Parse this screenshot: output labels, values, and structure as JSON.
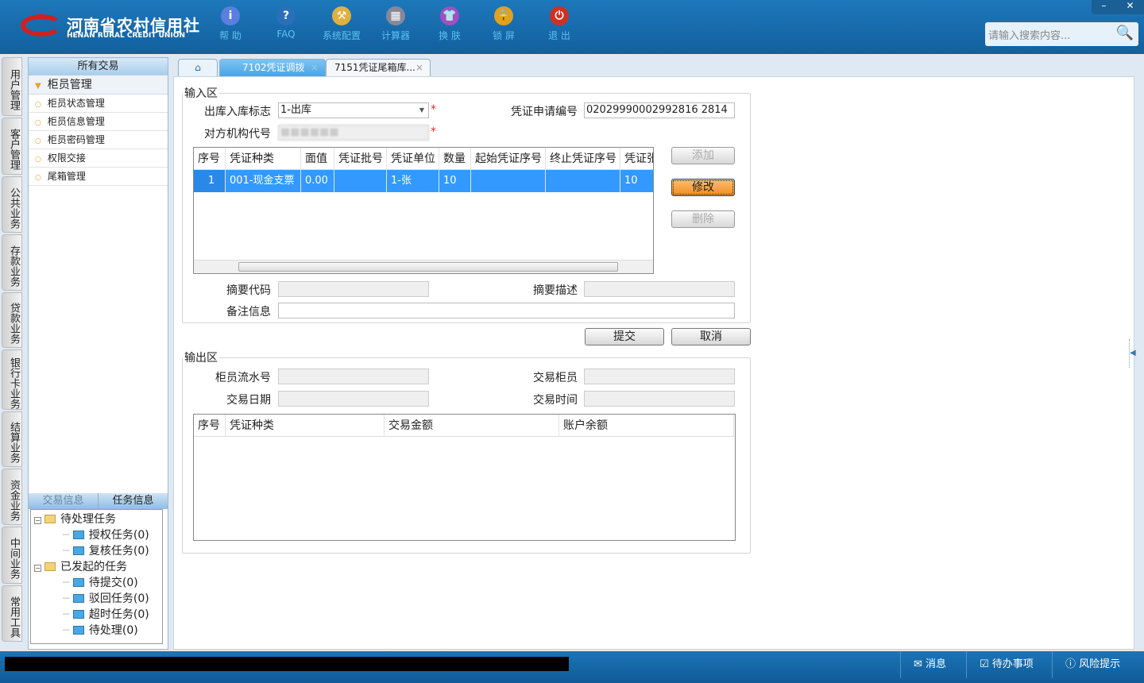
{
  "header": {
    "logo_cn": "河南省农村信用社",
    "logo_en": "HENAN RURAL CREDIT UNION",
    "tools": [
      {
        "label": "帮 助",
        "icon": "info-icon",
        "glyph": "i",
        "color": "#5b7fe0"
      },
      {
        "label": "FAQ",
        "icon": "help-icon",
        "glyph": "?",
        "color": "#2a6fb8"
      },
      {
        "label": "系统配置",
        "icon": "toolbox-icon",
        "glyph": "⚒",
        "color": "#e0b040"
      },
      {
        "label": "计算器",
        "icon": "calculator-icon",
        "glyph": "▦",
        "color": "#889"
      },
      {
        "label": "换 肤",
        "icon": "skin-icon",
        "glyph": "👕",
        "color": "#a050c0"
      },
      {
        "label": "锁 屏",
        "icon": "lock-icon",
        "glyph": "🔒",
        "color": "#e0a020"
      },
      {
        "label": "退 出",
        "icon": "power-icon",
        "glyph": "⏻",
        "color": "#d03020"
      }
    ],
    "search_placeholder": "请输入搜索内容...",
    "min": "–",
    "close": "✕"
  },
  "vtabs": [
    "用户管理",
    "客户管理",
    "公共业务",
    "存款业务",
    "贷款业务",
    "银行卡业务",
    "结算业务",
    "资金业务",
    "中间业务",
    "常用工具"
  ],
  "sidebar": {
    "title": "所有交易",
    "group": "柜员管理",
    "items": [
      "柜员状态管理",
      "柜员信息管理",
      "柜员密码管理",
      "权限交接",
      "尾箱管理"
    ],
    "tabs": [
      "交易信息",
      "任务信息"
    ],
    "tree": [
      {
        "label": "待处理任务",
        "level": 0
      },
      {
        "label": "授权任务(0)",
        "level": 1
      },
      {
        "label": "复核任务(0)",
        "level": 1
      },
      {
        "label": "已发起的任务",
        "level": 0
      },
      {
        "label": "待提交(0)",
        "level": 1
      },
      {
        "label": "驳回任务(0)",
        "level": 1
      },
      {
        "label": "超时任务(0)",
        "level": 1
      },
      {
        "label": "待处理(0)",
        "level": 1
      }
    ]
  },
  "tabs": {
    "t1": "7102凭证调拨",
    "t2": "7151凭证尾箱库..."
  },
  "input": {
    "legend": "输入区",
    "flag_label": "出库入库标志",
    "flag_value": "1-出库",
    "apply_label": "凭证申请编号",
    "apply_value": "02029990002992816 2814",
    "org_label": "对方机构代号",
    "org_value": "■■■■■■",
    "columns": [
      "序号",
      "凭证种类",
      "面值",
      "凭证批号",
      "凭证单位",
      "数量",
      "起始凭证序号",
      "终止凭证序号",
      "凭证张"
    ],
    "row": [
      "1",
      "001-现金支票",
      "0.00",
      "",
      "1-张",
      "10",
      "",
      "",
      "10"
    ],
    "add": "添加",
    "modify": "修改",
    "delete": "删除",
    "abs_code_label": "摘要代码",
    "abs_desc_label": "摘要描述",
    "remark_label": "备注信息",
    "submit": "提交",
    "cancel": "取消"
  },
  "output": {
    "legend": "输出区",
    "serial_label": "柜员流水号",
    "teller_label": "交易柜员",
    "date_label": "交易日期",
    "time_label": "交易时间",
    "columns": [
      "序号",
      "凭证种类",
      "交易金额",
      "账户余额"
    ]
  },
  "status": {
    "message": "消息",
    "todo": "待办事项",
    "risk": "风险提示"
  }
}
